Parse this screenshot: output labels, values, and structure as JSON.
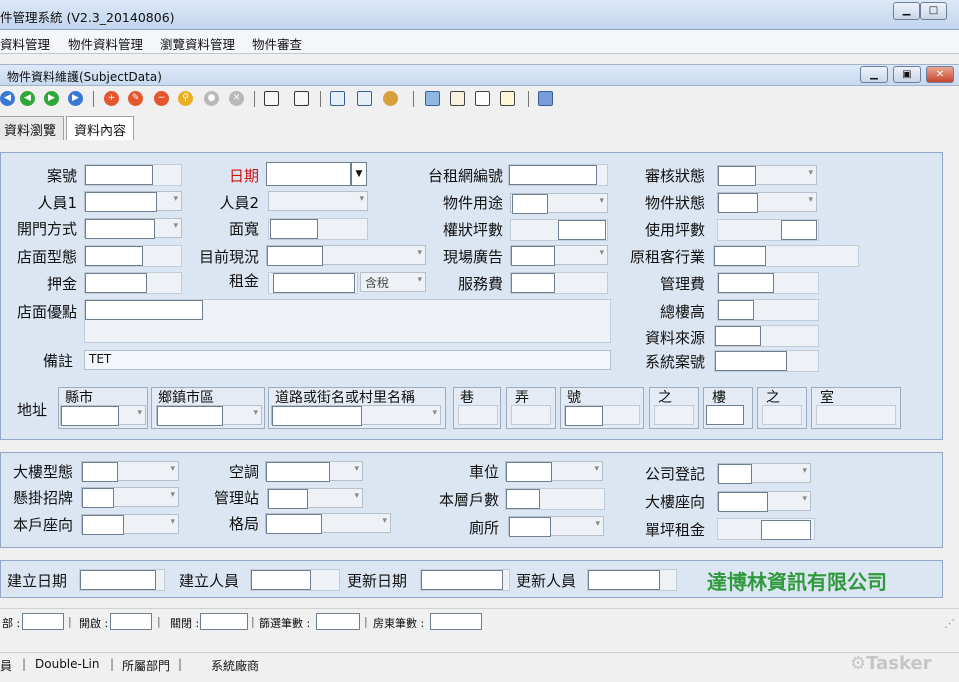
{
  "window": {
    "title": "件管理系統 (V2.3_20140806)"
  },
  "menu": {
    "items": [
      "資料管理",
      "物件資料管理",
      "瀏覽資料管理",
      "物件審查"
    ]
  },
  "child_window": {
    "title": "物件資料維護(SubjectData)"
  },
  "tabs": [
    "資料瀏覽",
    "資料內容"
  ],
  "form": {
    "case_no": "案號",
    "date": "日期",
    "web_no": "台租網編號",
    "review_status": "審核狀態",
    "staff1": "人員1",
    "staff2": "人員2",
    "usage": "物件用途",
    "property_status": "物件狀態",
    "opening": "開門方式",
    "width": "面寬",
    "ping": "權狀坪數",
    "use_ping": "使用坪數",
    "shop_type": "店面型態",
    "current": "目前現況",
    "onsite_ad": "現場廣告",
    "orig_tenant": "原租客行業",
    "deposit": "押金",
    "rent": "租金",
    "tax_opt": "含稅",
    "service_fee": "服務費",
    "mgmt_fee": "管理費",
    "advantages": "店面優點",
    "total_floors": "總樓高",
    "source": "資料來源",
    "remark": "備註",
    "remark_value": "TET",
    "sys_case_no": "系統案號",
    "address": "地址",
    "addr_cols": [
      "縣市",
      "鄉鎮市區",
      "道路或街名或村里名稱",
      "巷",
      "弄",
      "號",
      "之",
      "樓",
      "之",
      "室"
    ],
    "bld_type": "大樓型態",
    "ac": "空調",
    "parking": "車位",
    "company_reg": "公司登記",
    "signboard": "懸掛招牌",
    "mgmt_station": "管理站",
    "units_floor": "本層戶數",
    "bld_facing": "大樓座向",
    "unit_facing": "本戶座向",
    "layout": "格局",
    "toilet": "廁所",
    "unit_rent": "單坪租金",
    "created_date": "建立日期",
    "created_by": "建立人員",
    "updated_date": "更新日期",
    "updated_by": "更新人員",
    "company": "達博林資訊有限公司"
  },
  "status1": {
    "items": [
      "部 :",
      "開啟 :",
      "關閉 :",
      "篩選筆數 :",
      "房東筆數 :"
    ]
  },
  "status2": {
    "items": [
      "員",
      "Double-Lin",
      "所屬部門",
      "系統廠商"
    ],
    "logo": "Tasker"
  },
  "colors": {
    "required_label": "#d01010",
    "company_text": "#2e9a3c",
    "panel": "#dce6f3"
  }
}
